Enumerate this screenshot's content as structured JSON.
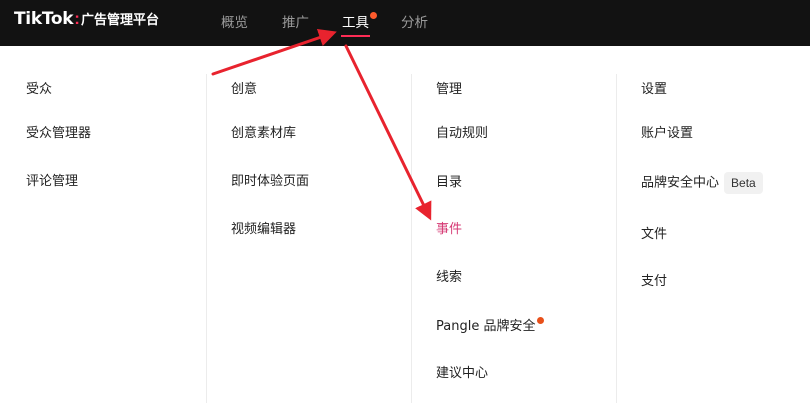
{
  "header": {
    "logo_brand": "TikTok",
    "logo_colon": ":",
    "logo_subtitle": "广告管理平台",
    "tabs": [
      {
        "label": "概览"
      },
      {
        "label": "推广"
      },
      {
        "label": "工具"
      },
      {
        "label": "分析"
      }
    ],
    "active_tab": "工具",
    "accent_color": "#fe2c55",
    "notification_dot_color": "#fe5b2c"
  },
  "menu": {
    "columns": [
      {
        "header": "受众",
        "items": [
          {
            "label": "受众管理器"
          },
          {
            "label": "评论管理"
          }
        ]
      },
      {
        "header": "创意",
        "items": [
          {
            "label": "创意素材库"
          },
          {
            "label": "即时体验页面"
          },
          {
            "label": "视频编辑器"
          }
        ]
      },
      {
        "header": "管理",
        "items": [
          {
            "label": "自动规则"
          },
          {
            "label": "目录"
          },
          {
            "label": "事件"
          },
          {
            "label": "线索"
          },
          {
            "label": "Pangle 品牌安全"
          },
          {
            "label": "建议中心"
          }
        ]
      },
      {
        "header": "设置",
        "items": [
          {
            "label": "账户设置"
          },
          {
            "label": "品牌安全中心",
            "badge": "Beta"
          },
          {
            "label": "文件"
          },
          {
            "label": "支付"
          }
        ]
      }
    ],
    "highlighted_item": "事件",
    "highlight_color": "#d63a74",
    "annotation_color": "#e8232e"
  }
}
